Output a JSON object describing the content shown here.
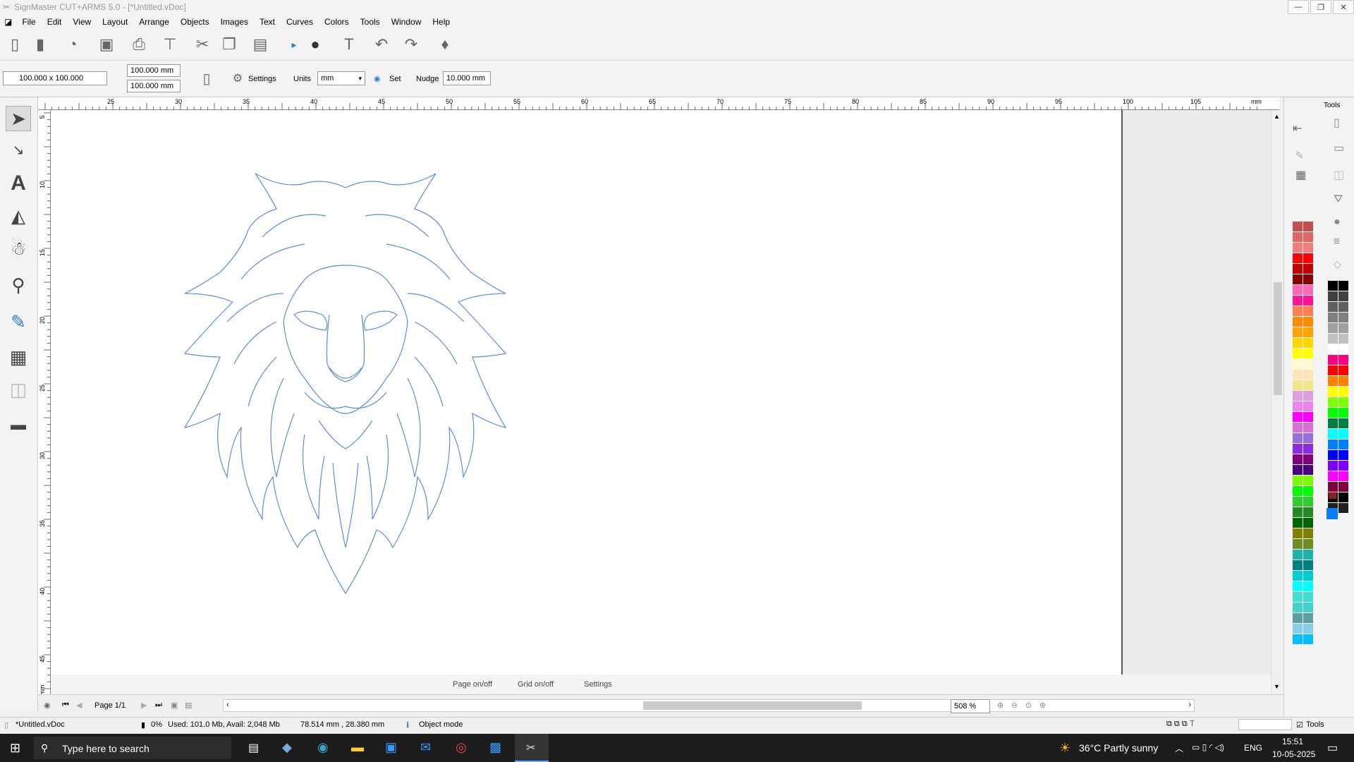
{
  "window": {
    "title": "SignMaster CUT+ARMS 5.0 - [*Untitled.vDoc]",
    "min": "—",
    "max": "❐",
    "close": "✕"
  },
  "menu": [
    "File",
    "Edit",
    "View",
    "Layout",
    "Arrange",
    "Objects",
    "Images",
    "Text",
    "Curves",
    "Colors",
    "Tools",
    "Window",
    "Help"
  ],
  "toolbar2": {
    "page_size": "100.000 x 100.000",
    "width": "100.000 mm",
    "height": "100.000 mm",
    "settings_label": "Settings",
    "units_label": "Units",
    "units_value": "mm",
    "set_label": "Set",
    "nudge_label": "Nudge",
    "nudge_value": "10.000 mm"
  },
  "ruler_top": [
    "25",
    "30",
    "35",
    "40",
    "45",
    "50",
    "55",
    "60",
    "65",
    "70",
    "75",
    "80",
    "85",
    "90",
    "95",
    "100",
    "105",
    "mm"
  ],
  "ruler_left": [
    "5",
    "10",
    "15",
    "20",
    "25",
    "30",
    "35",
    "40",
    "45",
    "mm"
  ],
  "canvas_bottom": {
    "page_toggle": "Page on/off",
    "grid_toggle": "Grid on/off",
    "settings": "Settings"
  },
  "pagebar": {
    "page": "Page 1/1",
    "zoom": "508 %"
  },
  "status": {
    "doc": "*Untitled.vDoc",
    "progress": "0%",
    "memory": "Used: 101.0 Mb, Avail: 2,048 Mb",
    "coords": "78.514 mm , 28.380 mm",
    "mode": "Object mode",
    "tools": "Tools"
  },
  "rightpanel": {
    "tools_label": "Tools"
  },
  "taskbar": {
    "search": "Type here to search",
    "weather": "36°C  Partly sunny",
    "lang": "ENG",
    "time": "15:51",
    "date": "10-05-2025"
  },
  "palette_left": [
    "#c0504d",
    "#e06666",
    "#f08080",
    "#ff0000",
    "#c00000",
    "#8b0000",
    "#ff69b4",
    "#ff1493",
    "#ff7f50",
    "#ff8c00",
    "#ffa500",
    "#ffd700",
    "#ffff00",
    "#fffacd",
    "#ffe4b5",
    "#f0e68c",
    "#dda0dd",
    "#ee82ee",
    "#ff00ff",
    "#da70d6",
    "#9370db",
    "#8a2be2",
    "#800080",
    "#4b0082",
    "#7cfc00",
    "#00ff00",
    "#32cd32",
    "#228b22",
    "#006400",
    "#808000",
    "#6b8e23",
    "#20b2aa",
    "#008080",
    "#00ced1",
    "#00ffff",
    "#40e0d0",
    "#48d1cc",
    "#5f9ea0",
    "#87ceeb",
    "#00bfff"
  ],
  "palette_right": [
    "#000000",
    "#404040",
    "#606060",
    "#808080",
    "#a0a0a0",
    "#c0c0c0",
    "#ffffff",
    "#ff0080",
    "#ff0000",
    "#ff8000",
    "#ffff00",
    "#80ff00",
    "#00ff00",
    "#008040",
    "#00ffff",
    "#0080ff",
    "#0000ff",
    "#8000ff",
    "#ff00ff",
    "#800040",
    "#000000",
    "#202020"
  ]
}
